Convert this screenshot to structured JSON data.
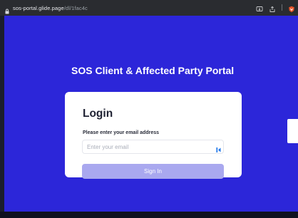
{
  "browser": {
    "url_host": "sos-portal.glide.page",
    "url_path": "/dl/1fac4c",
    "icons": [
      "lock-icon",
      "install-app-icon",
      "share-icon",
      "extension-icon"
    ]
  },
  "app": {
    "title": "SOS Client & Affected Party Portal",
    "background_color": "#2c26d9",
    "login": {
      "heading": "Login",
      "email_label": "Please enter your email address",
      "email_placeholder": "Enter your email",
      "email_value": "",
      "signin_label": "Sign In",
      "signin_color": "#a9a8ef"
    }
  }
}
